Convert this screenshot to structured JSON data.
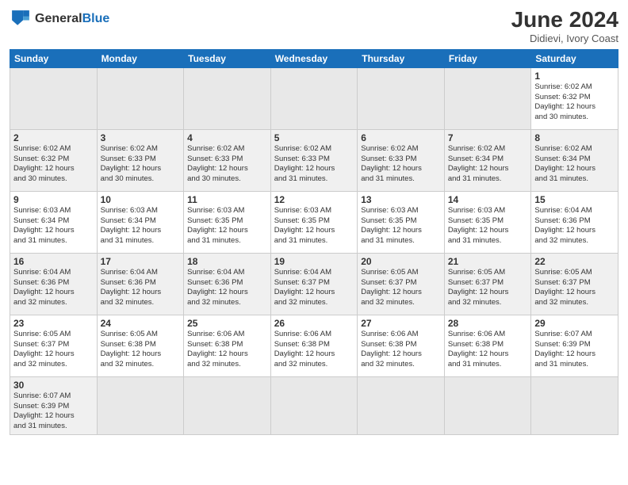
{
  "header": {
    "logo_general": "General",
    "logo_blue": "Blue",
    "title": "June 2024",
    "subtitle": "Didievi, Ivory Coast"
  },
  "weekdays": [
    "Sunday",
    "Monday",
    "Tuesday",
    "Wednesday",
    "Thursday",
    "Friday",
    "Saturday"
  ],
  "weeks": [
    [
      {
        "day": "",
        "empty": true
      },
      {
        "day": "",
        "empty": true
      },
      {
        "day": "",
        "empty": true
      },
      {
        "day": "",
        "empty": true
      },
      {
        "day": "",
        "empty": true
      },
      {
        "day": "",
        "empty": true
      },
      {
        "day": "1",
        "sunrise": "6:02 AM",
        "sunset": "6:32 PM",
        "daylight": "12 hours and 30 minutes."
      }
    ],
    [
      {
        "day": "2",
        "sunrise": "6:02 AM",
        "sunset": "6:32 PM",
        "daylight": "12 hours and 30 minutes."
      },
      {
        "day": "3",
        "sunrise": "6:02 AM",
        "sunset": "6:33 PM",
        "daylight": "12 hours and 30 minutes."
      },
      {
        "day": "4",
        "sunrise": "6:02 AM",
        "sunset": "6:33 PM",
        "daylight": "12 hours and 30 minutes."
      },
      {
        "day": "5",
        "sunrise": "6:02 AM",
        "sunset": "6:33 PM",
        "daylight": "12 hours and 31 minutes."
      },
      {
        "day": "6",
        "sunrise": "6:02 AM",
        "sunset": "6:33 PM",
        "daylight": "12 hours and 31 minutes."
      },
      {
        "day": "7",
        "sunrise": "6:02 AM",
        "sunset": "6:34 PM",
        "daylight": "12 hours and 31 minutes."
      },
      {
        "day": "8",
        "sunrise": "6:02 AM",
        "sunset": "6:34 PM",
        "daylight": "12 hours and 31 minutes."
      }
    ],
    [
      {
        "day": "9",
        "sunrise": "6:03 AM",
        "sunset": "6:34 PM",
        "daylight": "12 hours and 31 minutes."
      },
      {
        "day": "10",
        "sunrise": "6:03 AM",
        "sunset": "6:34 PM",
        "daylight": "12 hours and 31 minutes."
      },
      {
        "day": "11",
        "sunrise": "6:03 AM",
        "sunset": "6:35 PM",
        "daylight": "12 hours and 31 minutes."
      },
      {
        "day": "12",
        "sunrise": "6:03 AM",
        "sunset": "6:35 PM",
        "daylight": "12 hours and 31 minutes."
      },
      {
        "day": "13",
        "sunrise": "6:03 AM",
        "sunset": "6:35 PM",
        "daylight": "12 hours and 31 minutes."
      },
      {
        "day": "14",
        "sunrise": "6:03 AM",
        "sunset": "6:35 PM",
        "daylight": "12 hours and 31 minutes."
      },
      {
        "day": "15",
        "sunrise": "6:04 AM",
        "sunset": "6:36 PM",
        "daylight": "12 hours and 32 minutes."
      }
    ],
    [
      {
        "day": "16",
        "sunrise": "6:04 AM",
        "sunset": "6:36 PM",
        "daylight": "12 hours and 32 minutes."
      },
      {
        "day": "17",
        "sunrise": "6:04 AM",
        "sunset": "6:36 PM",
        "daylight": "12 hours and 32 minutes."
      },
      {
        "day": "18",
        "sunrise": "6:04 AM",
        "sunset": "6:36 PM",
        "daylight": "12 hours and 32 minutes."
      },
      {
        "day": "19",
        "sunrise": "6:04 AM",
        "sunset": "6:37 PM",
        "daylight": "12 hours and 32 minutes."
      },
      {
        "day": "20",
        "sunrise": "6:05 AM",
        "sunset": "6:37 PM",
        "daylight": "12 hours and 32 minutes."
      },
      {
        "day": "21",
        "sunrise": "6:05 AM",
        "sunset": "6:37 PM",
        "daylight": "12 hours and 32 minutes."
      },
      {
        "day": "22",
        "sunrise": "6:05 AM",
        "sunset": "6:37 PM",
        "daylight": "12 hours and 32 minutes."
      }
    ],
    [
      {
        "day": "23",
        "sunrise": "6:05 AM",
        "sunset": "6:37 PM",
        "daylight": "12 hours and 32 minutes."
      },
      {
        "day": "24",
        "sunrise": "6:05 AM",
        "sunset": "6:38 PM",
        "daylight": "12 hours and 32 minutes."
      },
      {
        "day": "25",
        "sunrise": "6:06 AM",
        "sunset": "6:38 PM",
        "daylight": "12 hours and 32 minutes."
      },
      {
        "day": "26",
        "sunrise": "6:06 AM",
        "sunset": "6:38 PM",
        "daylight": "12 hours and 32 minutes."
      },
      {
        "day": "27",
        "sunrise": "6:06 AM",
        "sunset": "6:38 PM",
        "daylight": "12 hours and 32 minutes."
      },
      {
        "day": "28",
        "sunrise": "6:06 AM",
        "sunset": "6:38 PM",
        "daylight": "12 hours and 31 minutes."
      },
      {
        "day": "29",
        "sunrise": "6:07 AM",
        "sunset": "6:39 PM",
        "daylight": "12 hours and 31 minutes."
      }
    ],
    [
      {
        "day": "30",
        "sunrise": "6:07 AM",
        "sunset": "6:39 PM",
        "daylight": "12 hours and 31 minutes."
      },
      {
        "day": "",
        "empty": true
      },
      {
        "day": "",
        "empty": true
      },
      {
        "day": "",
        "empty": true
      },
      {
        "day": "",
        "empty": true
      },
      {
        "day": "",
        "empty": true
      },
      {
        "day": "",
        "empty": true
      }
    ]
  ],
  "labels": {
    "sunrise": "Sunrise:",
    "sunset": "Sunset:",
    "daylight": "Daylight:"
  }
}
